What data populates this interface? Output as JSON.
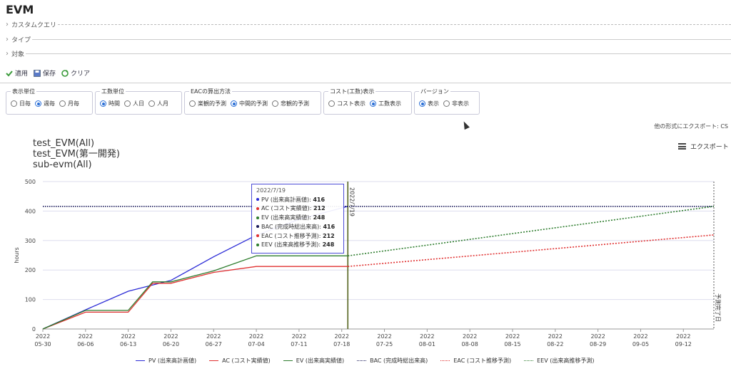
{
  "app": {
    "title": "EVM"
  },
  "sections": [
    {
      "label": "カスタムクエリ"
    },
    {
      "label": "タイプ"
    },
    {
      "label": "対象"
    }
  ],
  "actions": {
    "apply": "適用",
    "save": "保存",
    "clear": "クリア"
  },
  "filters": {
    "display_unit": {
      "legend": "表示単位",
      "options": [
        "日毎",
        "週毎",
        "月毎"
      ],
      "selected": "週毎"
    },
    "work_unit": {
      "legend": "工数単位",
      "options": [
        "時間",
        "人日",
        "人月"
      ],
      "selected": "時間"
    },
    "eac_method": {
      "legend": "EACの算出方法",
      "options": [
        "楽観的予測",
        "中間的予測",
        "悲観的予測"
      ],
      "selected": "中間的予測"
    },
    "cost_display": {
      "legend": "コスト(工数)表示",
      "options": [
        "コスト表示",
        "工数表示"
      ],
      "selected": "工数表示"
    },
    "version": {
      "legend": "バージョン",
      "options": [
        "表示",
        "非表示"
      ],
      "selected": "表示"
    }
  },
  "export_other": "他の形式にエクスポート: CS",
  "export_menu": "エクスポート",
  "chart_titles": [
    "test_EVM(All)",
    "test_EVM(第一開発)",
    "sub-evm(All)"
  ],
  "tooltip": {
    "date": "2022/7/19",
    "rows": [
      {
        "label": "PV (出来高計画値):",
        "value": "416",
        "color": "#2a2ad6"
      },
      {
        "label": "AC (コスト実績値):",
        "value": "212",
        "color": "#e03030"
      },
      {
        "label": "EV (出来高実績値):",
        "value": "248",
        "color": "#2e7d2e"
      },
      {
        "label": "BAC (完成時総出来高):",
        "value": "416",
        "color": "#1a1a5a"
      },
      {
        "label": "EAC (コスト推移予測):",
        "value": "212",
        "color": "#e03030"
      },
      {
        "label": "EEV (出来高推移予測):",
        "value": "248",
        "color": "#2e7d2e"
      }
    ]
  },
  "chart_data": {
    "type": "line",
    "ylabel": "hours",
    "ylim": [
      0,
      500
    ],
    "yticks": [
      0,
      100,
      200,
      300,
      400,
      500
    ],
    "x_ticks": [
      "2022-05-30",
      "2022-06-06",
      "2022-06-13",
      "2022-06-20",
      "2022-06-27",
      "2022-07-04",
      "2022-07-11",
      "2022-07-18",
      "2022-07-25",
      "2022-08-01",
      "2022-08-08",
      "2022-08-15",
      "2022-08-22",
      "2022-08-29",
      "2022-09-05",
      "2022-09-12"
    ],
    "x_range": [
      "2022-05-30",
      "2022-09-17"
    ],
    "grid": true,
    "legend_position": "bottom",
    "series": [
      {
        "name": "PV (出来高計画値)",
        "color": "#2a2ad6",
        "style": "solid",
        "points": [
          [
            "2022-05-30",
            0
          ],
          [
            "2022-06-06",
            65
          ],
          [
            "2022-06-13",
            128
          ],
          [
            "2022-06-20",
            165
          ],
          [
            "2022-06-27",
            245
          ],
          [
            "2022-07-04",
            318
          ],
          [
            "2022-07-11",
            372
          ],
          [
            "2022-07-19",
            416
          ]
        ]
      },
      {
        "name": "AC (コスト実績値)",
        "color": "#e03030",
        "style": "solid",
        "points": [
          [
            "2022-05-30",
            0
          ],
          [
            "2022-06-06",
            57
          ],
          [
            "2022-06-13",
            57
          ],
          [
            "2022-06-17",
            155
          ],
          [
            "2022-06-20",
            155
          ],
          [
            "2022-06-27",
            192
          ],
          [
            "2022-07-04",
            212
          ],
          [
            "2022-07-11",
            212
          ],
          [
            "2022-07-19",
            212
          ]
        ]
      },
      {
        "name": "EV (出来高実績値)",
        "color": "#2e7d2e",
        "style": "solid",
        "points": [
          [
            "2022-05-30",
            0
          ],
          [
            "2022-06-06",
            63
          ],
          [
            "2022-06-13",
            63
          ],
          [
            "2022-06-17",
            160
          ],
          [
            "2022-06-20",
            160
          ],
          [
            "2022-06-27",
            197
          ],
          [
            "2022-07-04",
            248
          ],
          [
            "2022-07-11",
            248
          ],
          [
            "2022-07-19",
            248
          ]
        ]
      },
      {
        "name": "BAC (完成時総出来高)",
        "color": "#1a1a5a",
        "style": "dotted",
        "points": [
          [
            "2022-05-30",
            416
          ],
          [
            "2022-09-17",
            416
          ]
        ]
      },
      {
        "name": "EAC (コスト推移予測)",
        "color": "#e03030",
        "style": "dotted",
        "points": [
          [
            "2022-07-19",
            212
          ],
          [
            "2022-09-17",
            319
          ]
        ]
      },
      {
        "name": "EEV (出来高推移予測)",
        "color": "#2e7d2e",
        "style": "dotted",
        "points": [
          [
            "2022-07-19",
            248
          ],
          [
            "2022-09-17",
            416
          ]
        ]
      }
    ],
    "markers": [
      {
        "label": "2022/7/19",
        "date": "2022-07-19",
        "color": "#4a5a10"
      },
      {
        "label": "予測完了日",
        "date": "2022-09-17",
        "color": "#555555"
      }
    ]
  }
}
